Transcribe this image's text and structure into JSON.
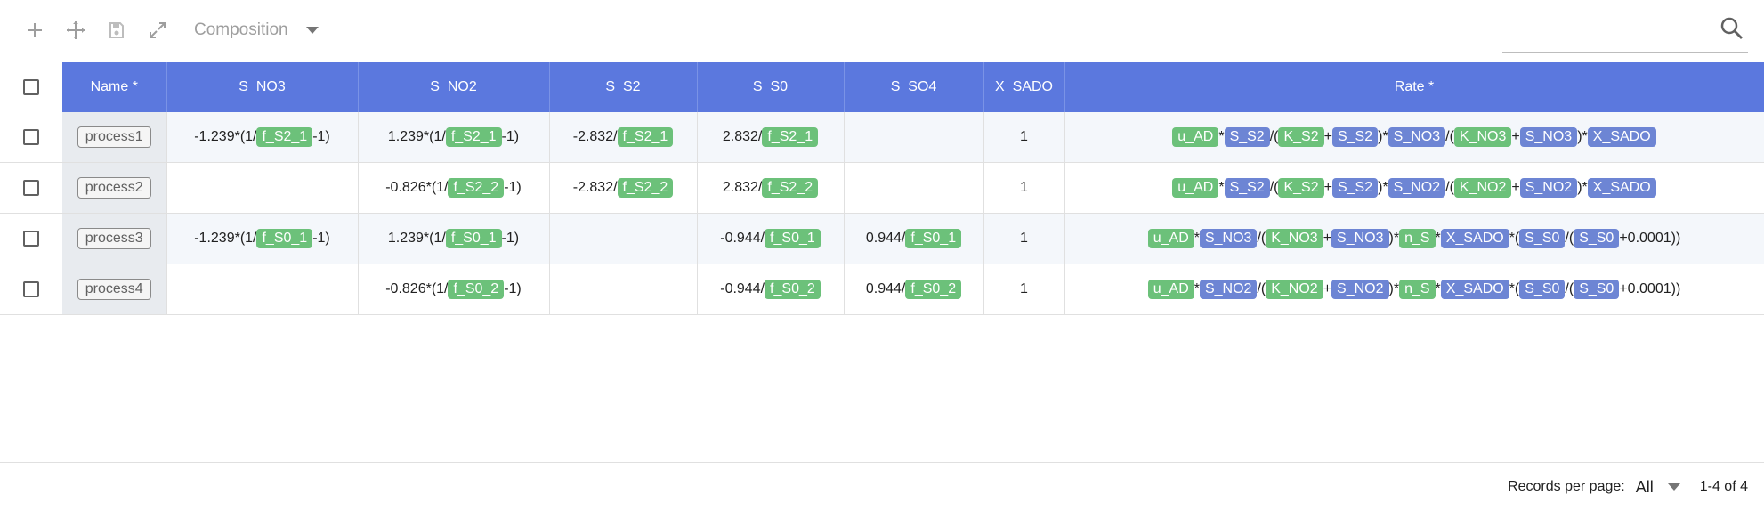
{
  "toolbar": {
    "model_label": "Composition",
    "search_placeholder": ""
  },
  "table": {
    "columns": [
      "Name *",
      "S_NO3",
      "S_NO2",
      "S_S2",
      "S_S0",
      "S_SO4",
      "X_SADO",
      "Rate *"
    ],
    "rows": [
      {
        "name": "process1",
        "S_NO3": [
          {
            "t": "-1.239*(1/"
          },
          {
            "g": "f_S2_1"
          },
          {
            "t": "-1)"
          }
        ],
        "S_NO2": [
          {
            "t": "1.239*(1/"
          },
          {
            "g": "f_S2_1"
          },
          {
            "t": "-1)"
          }
        ],
        "S_S2": [
          {
            "t": "-2.832/"
          },
          {
            "g": "f_S2_1"
          }
        ],
        "S_S0": [
          {
            "t": "2.832/"
          },
          {
            "g": "f_S2_1"
          }
        ],
        "S_SO4": [],
        "X_SADO": "1",
        "Rate": [
          {
            "g": "u_AD"
          },
          {
            "t": "*"
          },
          {
            "b": "S_S2"
          },
          {
            "t": "/("
          },
          {
            "g": "K_S2"
          },
          {
            "t": "+"
          },
          {
            "b": "S_S2"
          },
          {
            "t": ")*"
          },
          {
            "b": "S_NO3"
          },
          {
            "t": "/("
          },
          {
            "g": "K_NO3"
          },
          {
            "t": "+"
          },
          {
            "b": "S_NO3"
          },
          {
            "t": ")*"
          },
          {
            "b": "X_SADO"
          }
        ]
      },
      {
        "name": "process2",
        "S_NO3": [],
        "S_NO2": [
          {
            "t": "-0.826*(1/"
          },
          {
            "g": "f_S2_2"
          },
          {
            "t": "-1)"
          }
        ],
        "S_S2": [
          {
            "t": "-2.832/"
          },
          {
            "g": "f_S2_2"
          }
        ],
        "S_S0": [
          {
            "t": "2.832/"
          },
          {
            "g": "f_S2_2"
          }
        ],
        "S_SO4": [],
        "X_SADO": "1",
        "Rate": [
          {
            "g": "u_AD"
          },
          {
            "t": "*"
          },
          {
            "b": "S_S2"
          },
          {
            "t": "/("
          },
          {
            "g": "K_S2"
          },
          {
            "t": "+"
          },
          {
            "b": "S_S2"
          },
          {
            "t": ")*"
          },
          {
            "b": "S_NO2"
          },
          {
            "t": "/("
          },
          {
            "g": "K_NO2"
          },
          {
            "t": "+"
          },
          {
            "b": "S_NO2"
          },
          {
            "t": ")*"
          },
          {
            "b": "X_SADO"
          }
        ]
      },
      {
        "name": "process3",
        "S_NO3": [
          {
            "t": "-1.239*(1/"
          },
          {
            "g": "f_S0_1"
          },
          {
            "t": "-1)"
          }
        ],
        "S_NO2": [
          {
            "t": "1.239*(1/"
          },
          {
            "g": "f_S0_1"
          },
          {
            "t": "-1)"
          }
        ],
        "S_S2": [],
        "S_S0": [
          {
            "t": "-0.944/"
          },
          {
            "g": "f_S0_1"
          }
        ],
        "S_SO4": [
          {
            "t": "0.944/"
          },
          {
            "g": "f_S0_1"
          }
        ],
        "X_SADO": "1",
        "Rate": [
          {
            "g": "u_AD"
          },
          {
            "t": "*"
          },
          {
            "b": "S_NO3"
          },
          {
            "t": "/("
          },
          {
            "g": "K_NO3"
          },
          {
            "t": "+"
          },
          {
            "b": "S_NO3"
          },
          {
            "t": ")*"
          },
          {
            "g": "n_S"
          },
          {
            "t": "*"
          },
          {
            "b": "X_SADO"
          },
          {
            "t": "*("
          },
          {
            "b": "S_S0"
          },
          {
            "t": "/("
          },
          {
            "b": "S_S0"
          },
          {
            "t": "+0.0001))"
          }
        ]
      },
      {
        "name": "process4",
        "S_NO3": [],
        "S_NO2": [
          {
            "t": "-0.826*(1/"
          },
          {
            "g": "f_S0_2"
          },
          {
            "t": "-1)"
          }
        ],
        "S_S2": [],
        "S_S0": [
          {
            "t": "-0.944/"
          },
          {
            "g": "f_S0_2"
          }
        ],
        "S_SO4": [
          {
            "t": "0.944/"
          },
          {
            "g": "f_S0_2"
          }
        ],
        "X_SADO": "1",
        "Rate": [
          {
            "g": "u_AD"
          },
          {
            "t": "*"
          },
          {
            "b": "S_NO2"
          },
          {
            "t": "/("
          },
          {
            "g": "K_NO2"
          },
          {
            "t": "+"
          },
          {
            "b": "S_NO2"
          },
          {
            "t": ")*"
          },
          {
            "g": "n_S"
          },
          {
            "t": "*"
          },
          {
            "b": "X_SADO"
          },
          {
            "t": "*("
          },
          {
            "b": "S_S0"
          },
          {
            "t": "/("
          },
          {
            "b": "S_S0"
          },
          {
            "t": "+0.0001))"
          }
        ]
      }
    ]
  },
  "footer": {
    "rows_per_page_label": "Records per page:",
    "rows_per_page_value": "All",
    "range_text": "1-4 of 4"
  },
  "colors": {
    "header_bg": "#5b78de",
    "parameter_token": "#6cc17a",
    "component_token": "#6d85d4"
  },
  "icons": [
    "plus-icon",
    "move-icon",
    "save-icon",
    "expand-icon",
    "caret-down-icon",
    "search-icon"
  ]
}
